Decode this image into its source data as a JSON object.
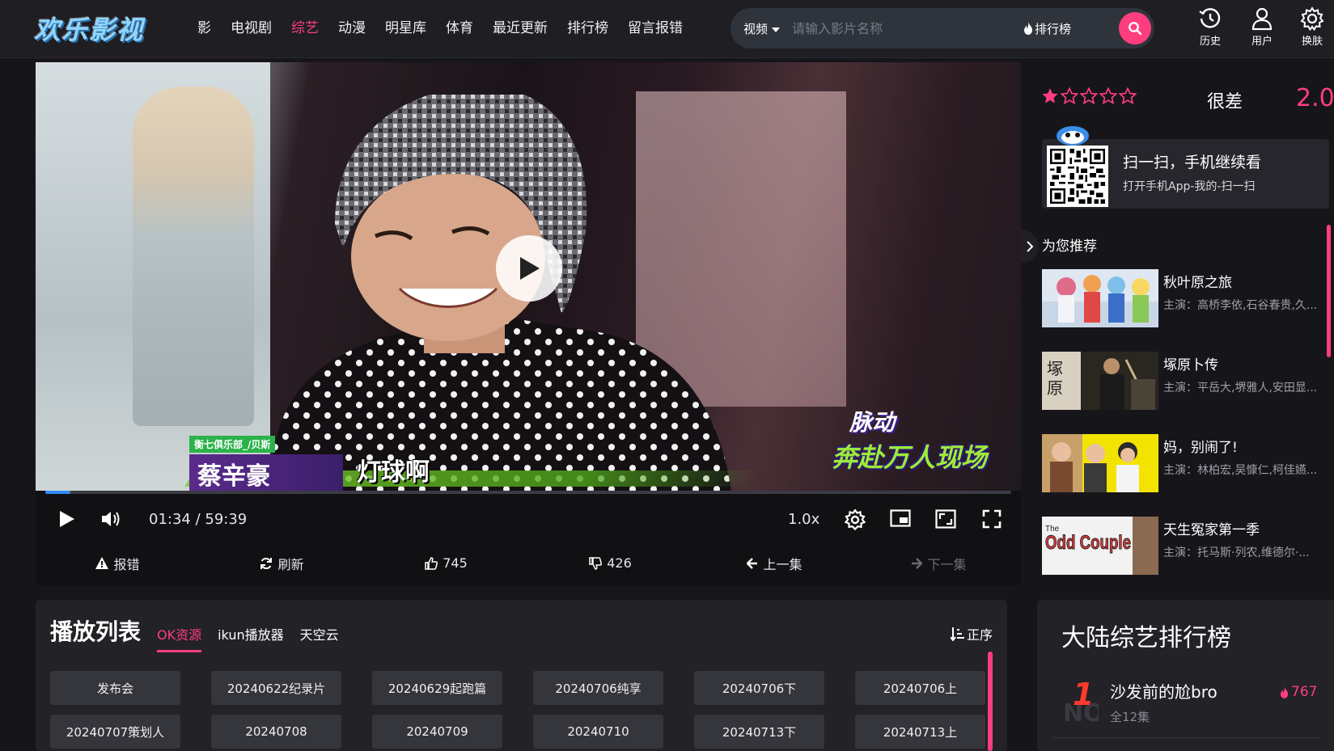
{
  "header": {
    "logo": "欢乐影视",
    "nav": [
      "影",
      "电视剧",
      "综艺",
      "动漫",
      "明星库",
      "体育",
      "最近更新",
      "排行榜",
      "留言报错"
    ],
    "nav_active_index": 2,
    "search": {
      "type_label": "视频",
      "placeholder": "请输入影片名称",
      "rank_label": "排行榜"
    },
    "tools": {
      "history": "历史",
      "user": "用户",
      "skin": "换肤"
    }
  },
  "player": {
    "caption": "灯球啊",
    "name_tag_org": "衡七俱乐部_/贝斯",
    "name_tag_name": "蔡辛豪",
    "badge_line1": "脉动",
    "badge_line2": "奔赴万人现场",
    "current_time": "01:34",
    "duration": "59:39",
    "time_separator": " / ",
    "progress_fraction": 0.026,
    "speed": "1.0x",
    "actions": {
      "report": "报错",
      "refresh": "刷新",
      "likes": "745",
      "dislikes": "426",
      "prev": "上一集",
      "next": "下一集"
    }
  },
  "rating": {
    "stars_filled": 1,
    "stars_total": 5,
    "label": "很差",
    "score": "2.0"
  },
  "qr": {
    "title": "扫一扫，手机继续看",
    "subtitle": "打开手机App-我的-扫一扫"
  },
  "recommend": {
    "title": "为您推荐",
    "items": [
      {
        "name": "秋叶原之旅",
        "cast": "主演：高桥李依,石谷春贵,久..."
      },
      {
        "name": "塚原卜传",
        "cast": "主演：平岳大,堺雅人,安田显..."
      },
      {
        "name": "妈，别闹了!",
        "cast": "主演：林柏宏,吴慷仁,柯佳嬿..."
      },
      {
        "name": "天生冤家第一季",
        "cast": "主演：托马斯·列农,维德尔·..."
      }
    ],
    "thumb3_text": "Odd Couple",
    "thumb3_small": "The"
  },
  "playlist": {
    "title": "播放列表",
    "tabs": [
      "OK资源",
      "ikun播放器",
      "天空云"
    ],
    "active_tab": 0,
    "sort_label": "正序",
    "episodes": [
      "发布会",
      "20240622纪录片",
      "20240629起跑篇",
      "20240706纯享",
      "20240706下",
      "20240706上",
      "20240707策划人",
      "20240708",
      "20240709",
      "20240710",
      "20240713下",
      "20240713上"
    ]
  },
  "ranking": {
    "title": "大陆综艺排行榜",
    "items": [
      {
        "rank": "1",
        "name": "沙发前的尬bro",
        "episodes": "全12集",
        "hot": "767"
      }
    ]
  },
  "colors": {
    "accent": "#ff3e7f",
    "progress": "#2e8bff"
  }
}
